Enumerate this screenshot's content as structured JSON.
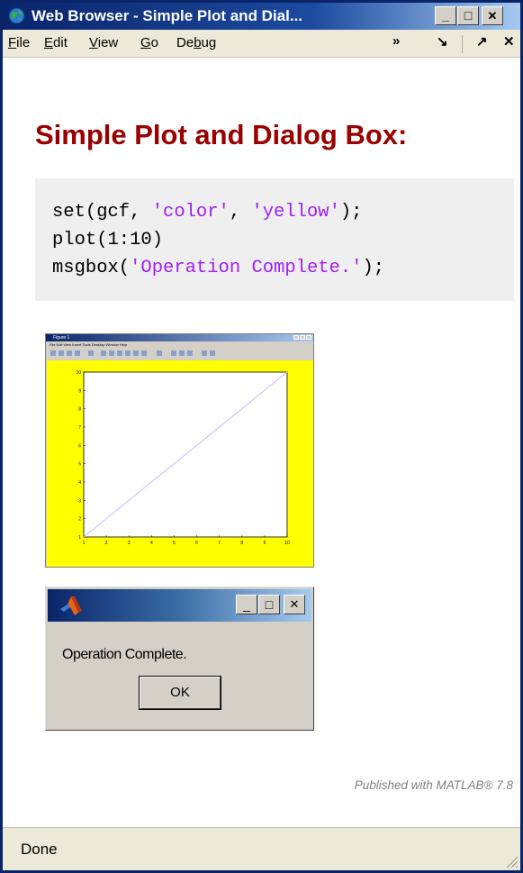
{
  "window": {
    "title": "Web Browser - Simple Plot and Dial...",
    "min_glyph": "_",
    "max_glyph": "□",
    "close_glyph": "✕"
  },
  "menu": {
    "items": [
      {
        "pre": "",
        "u": "F",
        "post": "ile"
      },
      {
        "pre": "",
        "u": "E",
        "post": "dit"
      },
      {
        "pre": "",
        "u": "V",
        "post": "iew"
      },
      {
        "pre": "",
        "u": "G",
        "post": "o"
      },
      {
        "pre": "De",
        "u": "b",
        "post": "ug"
      }
    ],
    "overflow_glyph": "»",
    "dock_glyph": "↘",
    "undock_glyph": "↗",
    "close_glyph": "✕"
  },
  "page": {
    "heading": "Simple Plot and Dialog Box:",
    "code": [
      {
        "pre": "set(gcf, ",
        "s1": "'color'",
        "mid": ", ",
        "s2": "'yellow'",
        "post": ");"
      },
      {
        "pre": "plot(1:10)",
        "s1": "",
        "mid": "",
        "s2": "",
        "post": ""
      },
      {
        "pre": "msgbox(",
        "s1": "'Operation Complete.'",
        "mid": "",
        "s2": "",
        "post": ");"
      }
    ],
    "figure": {
      "title": "Figure 1",
      "menu": "File  Edit  View  Insert  Tools  Desktop  Window  Help",
      "chart_data": {
        "type": "line",
        "x": [
          1,
          2,
          3,
          4,
          5,
          6,
          7,
          8,
          9,
          10
        ],
        "y": [
          1,
          2,
          3,
          4,
          5,
          6,
          7,
          8,
          9,
          10
        ],
        "xlim": [
          1,
          10
        ],
        "ylim": [
          1,
          10
        ],
        "xticks": [
          "1",
          "2",
          "3",
          "4",
          "5",
          "6",
          "7",
          "8",
          "9",
          "10"
        ],
        "yticks": [
          "1",
          "2",
          "3",
          "4",
          "5",
          "6",
          "7",
          "8",
          "9",
          "10"
        ],
        "grid": false,
        "figure_color": "#ffff00",
        "line_color": "#c8c8ff"
      }
    },
    "dialog": {
      "message": "Operation Complete.",
      "ok_label": "OK",
      "icon": "matlab-logo-icon"
    },
    "published": "Published with MATLAB® 7.8"
  },
  "status": {
    "text": "Done"
  }
}
